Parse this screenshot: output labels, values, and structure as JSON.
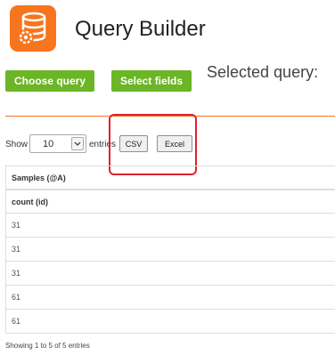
{
  "header": {
    "title": "Query Builder",
    "logo_icon": "database-gear-icon",
    "logo_color": "#f7751e"
  },
  "toolbar": {
    "choose_query_label": "Choose query",
    "select_fields_label": "Select fields",
    "selected_query_label": "Selected query:",
    "accent": "#6bb526"
  },
  "table_controls": {
    "show_label": "Show",
    "page_size_value": "10",
    "entries_label": "entries",
    "csv_label": "CSV",
    "excel_label": "Excel"
  },
  "table": {
    "headers": [
      "Samples (@A)",
      "count (id)"
    ],
    "rows": [
      "31",
      "31",
      "31",
      "61",
      "61"
    ]
  },
  "footer": {
    "info": "Showing 1 to 5 of 5 entries"
  }
}
